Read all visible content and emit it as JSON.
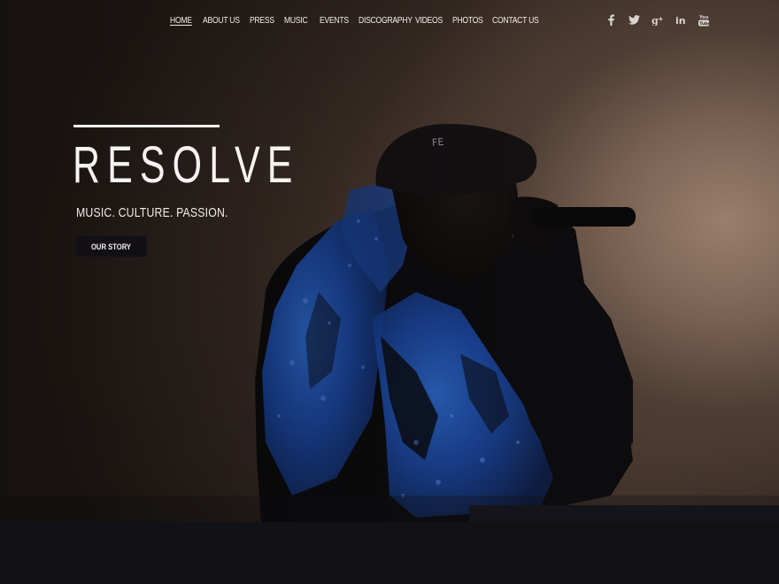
{
  "nav": {
    "items": [
      {
        "label": "HOME",
        "active": true
      },
      {
        "label": "ABOUT US",
        "active": false
      },
      {
        "label": "PRESS",
        "active": false
      },
      {
        "label": "MUSIC",
        "active": false
      },
      {
        "label": "EVENTS",
        "active": false
      },
      {
        "label": "DISCOGRAPHY",
        "active": false
      },
      {
        "label": "VIDEOS",
        "active": false
      },
      {
        "label": "PHOTOS",
        "active": false
      },
      {
        "label": "CONTACT US",
        "active": false
      }
    ]
  },
  "social": {
    "icons": [
      "facebook-icon",
      "twitter-icon",
      "google-plus-icon",
      "linkedin-icon",
      "youtube-icon"
    ]
  },
  "hero": {
    "title": "RESOLVE",
    "tagline": "MUSIC. CULTURE. PASSION.",
    "cta_label": "OUR STORY",
    "cap_text": "FE"
  },
  "colors": {
    "accent_light": "#f6f3f0",
    "button_bg": "#121015",
    "jacket_blue": "#1d4fb0",
    "background_dark": "#111014"
  }
}
